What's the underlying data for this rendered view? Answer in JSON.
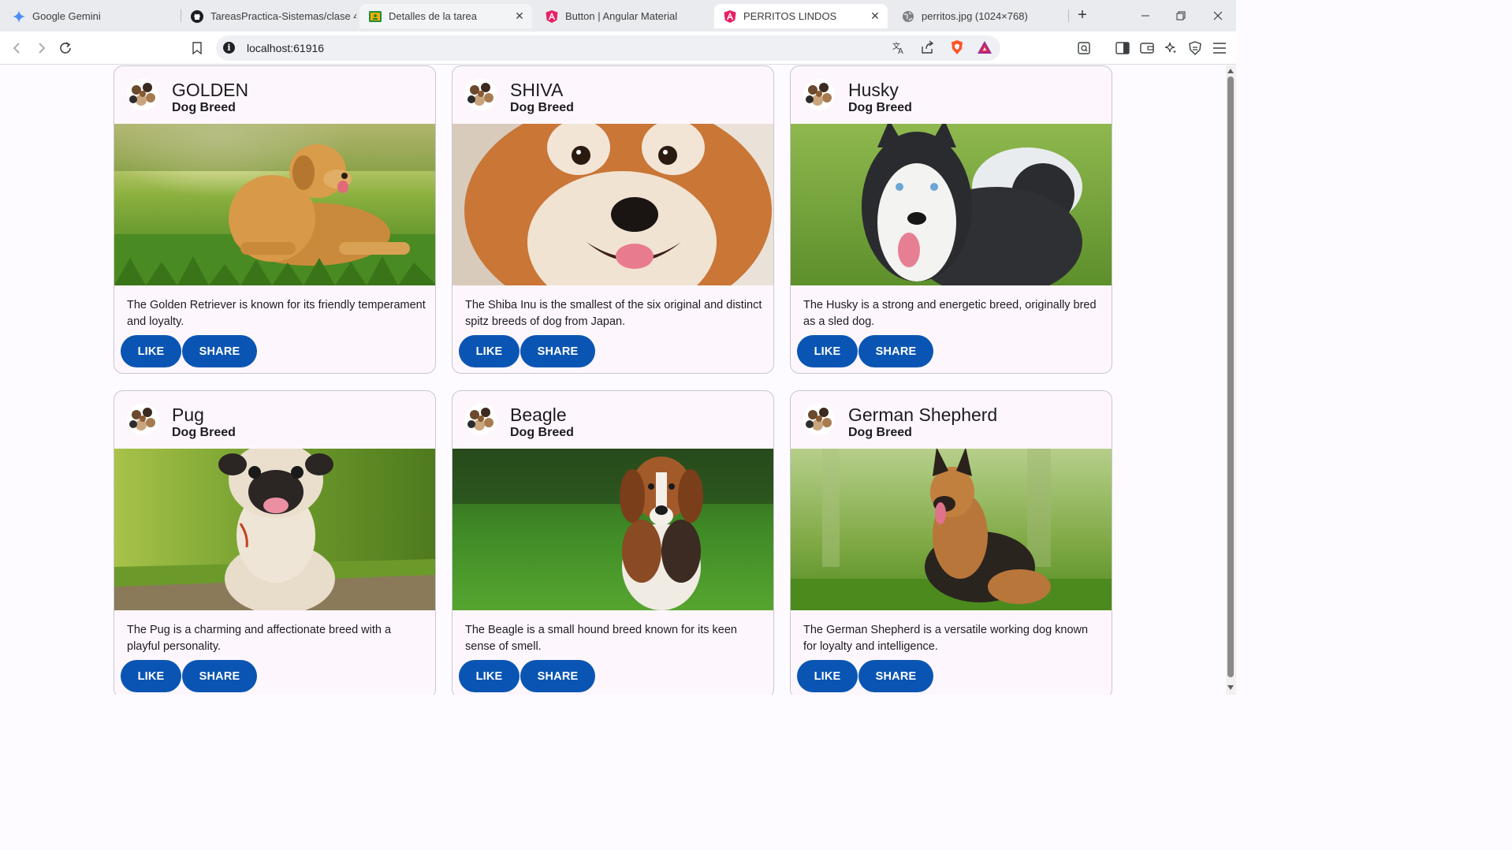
{
  "browser": {
    "tabs": [
      {
        "label": "Google Gemini",
        "icon": "gemini-icon",
        "active": false
      },
      {
        "label": "TareasPractica-Sistemas/clase 4",
        "icon": "github-icon",
        "active": false
      },
      {
        "label": "Detalles de la tarea",
        "icon": "classroom-icon",
        "active": false,
        "close": "✕"
      },
      {
        "label": "Button | Angular Material",
        "icon": "angular-icon",
        "active": false
      },
      {
        "label": "PERRITOS LINDOS",
        "icon": "angular-icon",
        "active": true,
        "close": "✕"
      },
      {
        "label": "perritos.jpg (1024×768)",
        "icon": "globe-icon",
        "active": false
      }
    ],
    "new_tab": "+",
    "url": "localhost:61916"
  },
  "cards": [
    {
      "title": "GOLDEN",
      "subtitle": "Dog Breed",
      "description": "The Golden Retriever is known for its friendly temperament and loyalty.",
      "like": "LIKE",
      "share": "SHARE"
    },
    {
      "title": "SHIVA",
      "subtitle": "Dog Breed",
      "description": "The Shiba Inu is the smallest of the six original and distinct spitz breeds of dog from Japan.",
      "like": "LIKE",
      "share": "SHARE"
    },
    {
      "title": "Husky",
      "subtitle": "Dog Breed",
      "description": "The Husky is a strong and energetic breed, originally bred as a sled dog.",
      "like": "LIKE",
      "share": "SHARE"
    },
    {
      "title": "Pug",
      "subtitle": "Dog Breed",
      "description": "The Pug is a charming and affectionate breed with a playful personality.",
      "like": "LIKE",
      "share": "SHARE"
    },
    {
      "title": "Beagle",
      "subtitle": "Dog Breed",
      "description": "The Beagle is a small hound breed known for its keen sense of smell.",
      "like": "LIKE",
      "share": "SHARE"
    },
    {
      "title": "German Shepherd",
      "subtitle": "Dog Breed",
      "description": "The German Shepherd is a versatile working dog known for loyalty and intelligence.",
      "like": "LIKE",
      "share": "SHARE"
    }
  ],
  "colors": {
    "button": "#0a55b3",
    "card_bg": "#fdf7fd",
    "card_border": "#cac4d0"
  }
}
